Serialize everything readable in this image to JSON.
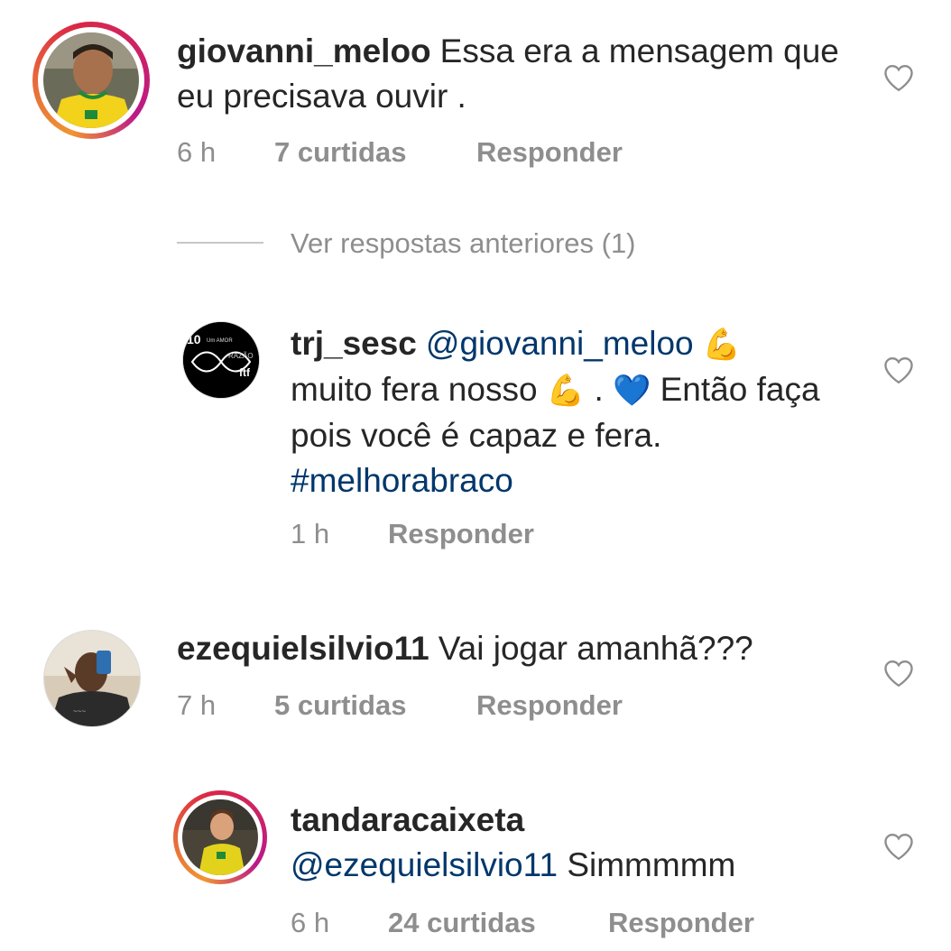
{
  "comments": [
    {
      "username": "giovanni_meloo",
      "text": "Essa era a mensagem que eu precisava ouvir .",
      "time": "6 h",
      "likes": "7 curtidas",
      "reply": "Responder"
    },
    {
      "username": "trj_sesc",
      "mention": "@giovanni_meloo",
      "emoji1": "💪",
      "text_a": "muito fera nosso",
      "emoji2": "💪",
      "dot": ".",
      "emoji3": "💙",
      "text_b": "Então faça pois você é capaz e fera.",
      "hashtag": "#melhorabraco",
      "time": "1 h",
      "reply": "Responder"
    },
    {
      "username": "ezequielsilvio11",
      "text": "Vai jogar amanhã???",
      "time": "7 h",
      "likes": "5 curtidas",
      "reply": "Responder"
    },
    {
      "username": "tandaracaixeta",
      "mention": "@ezequielsilvio11",
      "text": "Simmmmm",
      "time": "6 h",
      "likes": "24 curtidas",
      "reply": "Responder"
    }
  ],
  "view_replies": "Ver respostas anteriores (1)",
  "icons": {
    "like": "heart-outline-icon"
  },
  "colors": {
    "link": "#00376b",
    "meta": "#8e8e8e",
    "text": "#262626"
  }
}
